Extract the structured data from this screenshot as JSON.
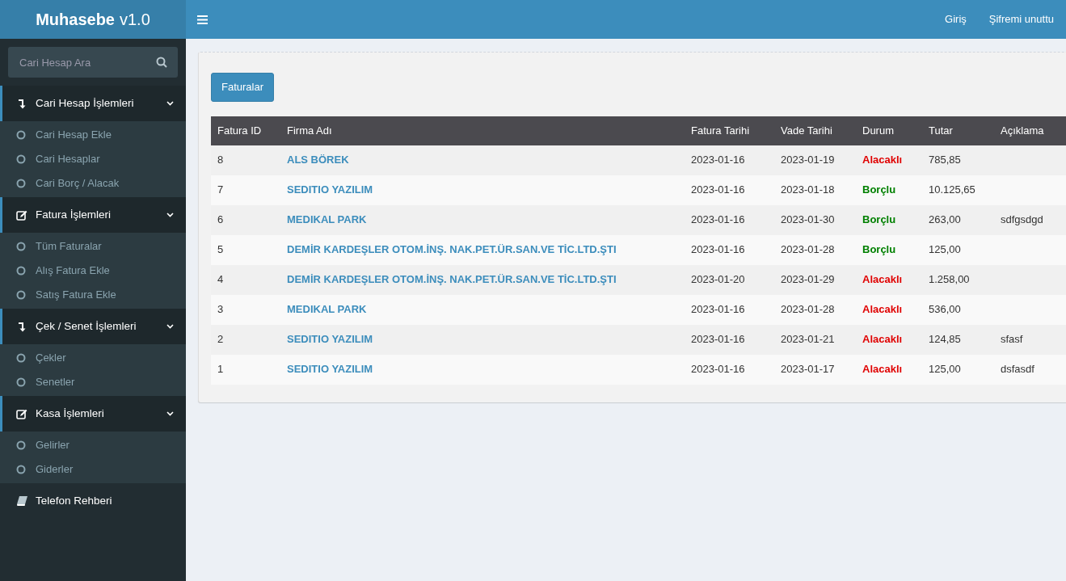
{
  "brand": {
    "name": "Muhasebe",
    "version": "v1.0"
  },
  "top_links": [
    "Giriş",
    "Şifremi unuttu"
  ],
  "search": {
    "placeholder": "Cari Hesap Ara"
  },
  "sidebar": {
    "items": [
      {
        "label": "Cari Hesap İşlemleri",
        "kind": "arrow",
        "expanded": true,
        "children": [
          {
            "label": "Cari Hesap Ekle"
          },
          {
            "label": "Cari Hesaplar"
          },
          {
            "label": "Cari Borç / Alacak"
          }
        ]
      },
      {
        "label": "Fatura İşlemleri",
        "kind": "edit",
        "expanded": true,
        "children": [
          {
            "label": "Tüm Faturalar"
          },
          {
            "label": "Alış Fatura Ekle"
          },
          {
            "label": "Satış Fatura Ekle"
          }
        ]
      },
      {
        "label": "Çek / Senet İşlemleri",
        "kind": "arrow",
        "expanded": true,
        "children": [
          {
            "label": "Çekler"
          },
          {
            "label": "Senetler"
          }
        ]
      },
      {
        "label": "Kasa İşlemleri",
        "kind": "edit",
        "expanded": true,
        "children": [
          {
            "label": "Gelirler"
          },
          {
            "label": "Giderler"
          }
        ]
      },
      {
        "label": "Telefon Rehberi",
        "kind": "book"
      }
    ]
  },
  "button": "Faturalar",
  "table": {
    "columns": [
      "Fatura ID",
      "Firma Adı",
      "Fatura Tarihi",
      "Vade Tarihi",
      "Durum",
      "Tutar",
      "Açıklama"
    ],
    "rows": [
      {
        "id": "8",
        "firm": "ALS BÖREK",
        "invoice_date": "2023-01-16",
        "due_date": "2023-01-19",
        "status": "Alacaklı",
        "color": "#e00000",
        "amount": "785,85"
      },
      {
        "id": "7",
        "firm": "SEDITIO YAZILIM",
        "invoice_date": "2023-01-16",
        "due_date": "2023-01-18",
        "status": "Borçlu",
        "color": "#008000",
        "amount": "10.125,65"
      },
      {
        "id": "6",
        "firm": "MEDIKAL PARK",
        "invoice_date": "2023-01-16",
        "due_date": "2023-01-30",
        "status": "Borçlu",
        "color": "#008000",
        "amount": "263,00",
        "note": "sdfgsdgd"
      },
      {
        "id": "5",
        "firm": "DEMİR KARDEŞLER OTOM.İNŞ. NAK.PET.ÜR.SAN.VE TİC.LTD.ŞTI",
        "invoice_date": "2023-01-16",
        "due_date": "2023-01-28",
        "status": "Borçlu",
        "color": "#008000",
        "amount": "125,00"
      },
      {
        "id": "4",
        "firm": "DEMİR KARDEŞLER OTOM.İNŞ. NAK.PET.ÜR.SAN.VE TİC.LTD.ŞTI",
        "invoice_date": "2023-01-20",
        "due_date": "2023-01-29",
        "status": "Alacaklı",
        "color": "#e00000",
        "amount": "1.258,00"
      },
      {
        "id": "3",
        "firm": "MEDIKAL PARK",
        "invoice_date": "2023-01-16",
        "due_date": "2023-01-28",
        "status": "Alacaklı",
        "color": "#e00000",
        "amount": "536,00"
      },
      {
        "id": "2",
        "firm": "SEDITIO YAZILIM",
        "invoice_date": "2023-01-16",
        "due_date": "2023-01-21",
        "status": "Alacaklı",
        "color": "#e00000",
        "amount": "124,85",
        "note": "sfasf"
      },
      {
        "id": "1",
        "firm": "SEDITIO YAZILIM",
        "invoice_date": "2023-01-16",
        "due_date": "2023-01-17",
        "status": "Alacaklı",
        "color": "#e00000",
        "amount": "125,00",
        "note": "dsfasdf"
      }
    ]
  }
}
